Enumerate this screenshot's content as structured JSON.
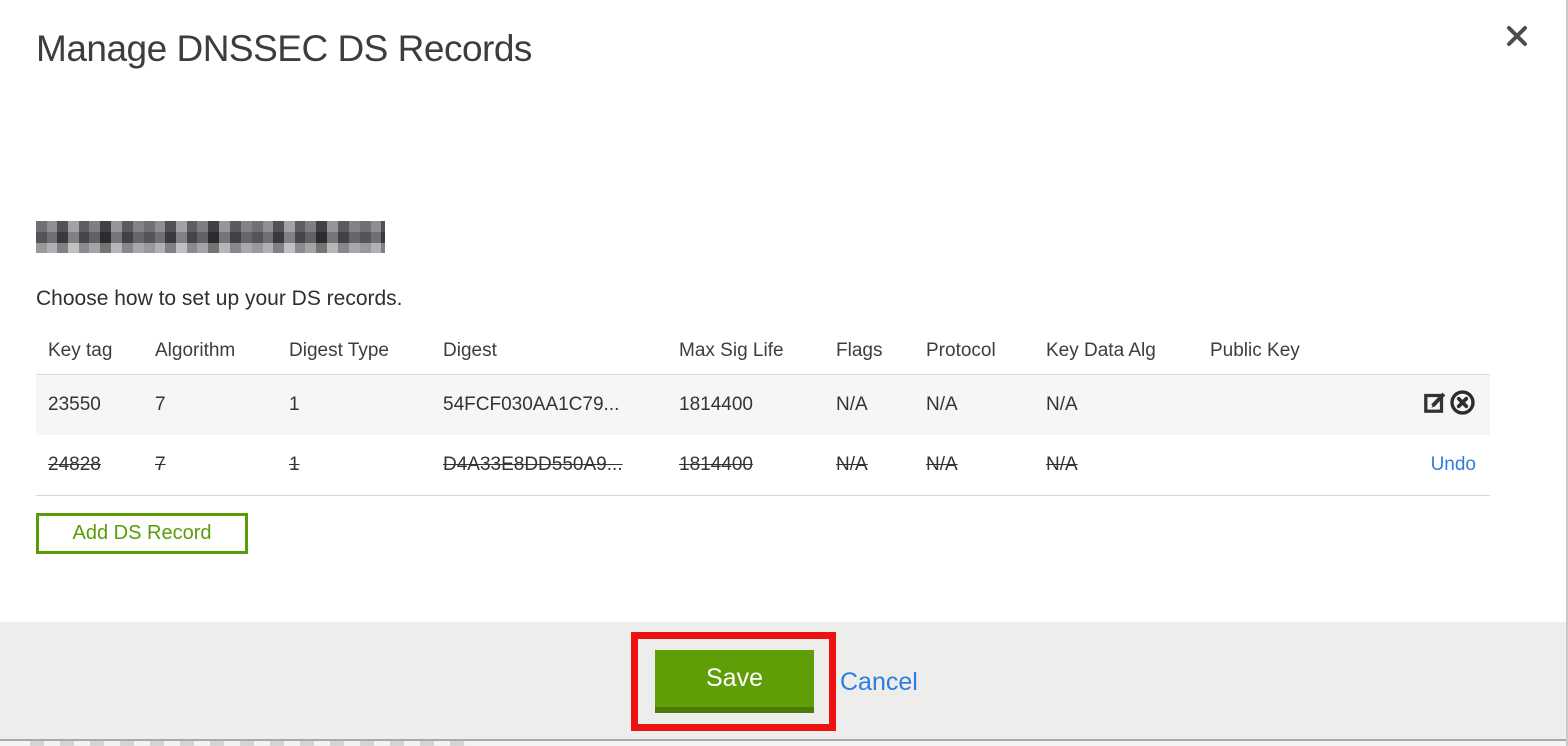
{
  "modal": {
    "title": "Manage DNSSEC DS Records",
    "intro": "Choose how to set up your DS records."
  },
  "table": {
    "columns": {
      "key_tag": "Key tag",
      "algorithm": "Algorithm",
      "digest_type": "Digest Type",
      "digest": "Digest",
      "max_sig_life": "Max Sig Life",
      "flags": "Flags",
      "protocol": "Protocol",
      "key_data_alg": "Key Data Alg",
      "public_key": "Public Key"
    },
    "rows": [
      {
        "key_tag": "23550",
        "algorithm": "7",
        "digest_type": "1",
        "digest": "54FCF030AA1C79...",
        "max_sig_life": "1814400",
        "flags": "N/A",
        "protocol": "N/A",
        "key_data_alg": "N/A",
        "public_key": "",
        "state": "normal"
      },
      {
        "key_tag": "24828",
        "algorithm": "7",
        "digest_type": "1",
        "digest": "D4A33E8DD550A9...",
        "max_sig_life": "1814400",
        "flags": "N/A",
        "protocol": "N/A",
        "key_data_alg": "N/A",
        "public_key": "",
        "state": "deleted",
        "undo_label": "Undo"
      }
    ]
  },
  "buttons": {
    "add_ds_record": "Add DS Record",
    "save": "Save",
    "cancel": "Cancel"
  },
  "colors": {
    "green": "#5a9c08",
    "green_button": "#5f9e06",
    "green_button_dark": "#4a7b04",
    "link_blue": "#2e7de0",
    "annotation_red": "#ec1212",
    "footer_gray": "#ededec",
    "row_stripe": "#f6f6f6"
  }
}
